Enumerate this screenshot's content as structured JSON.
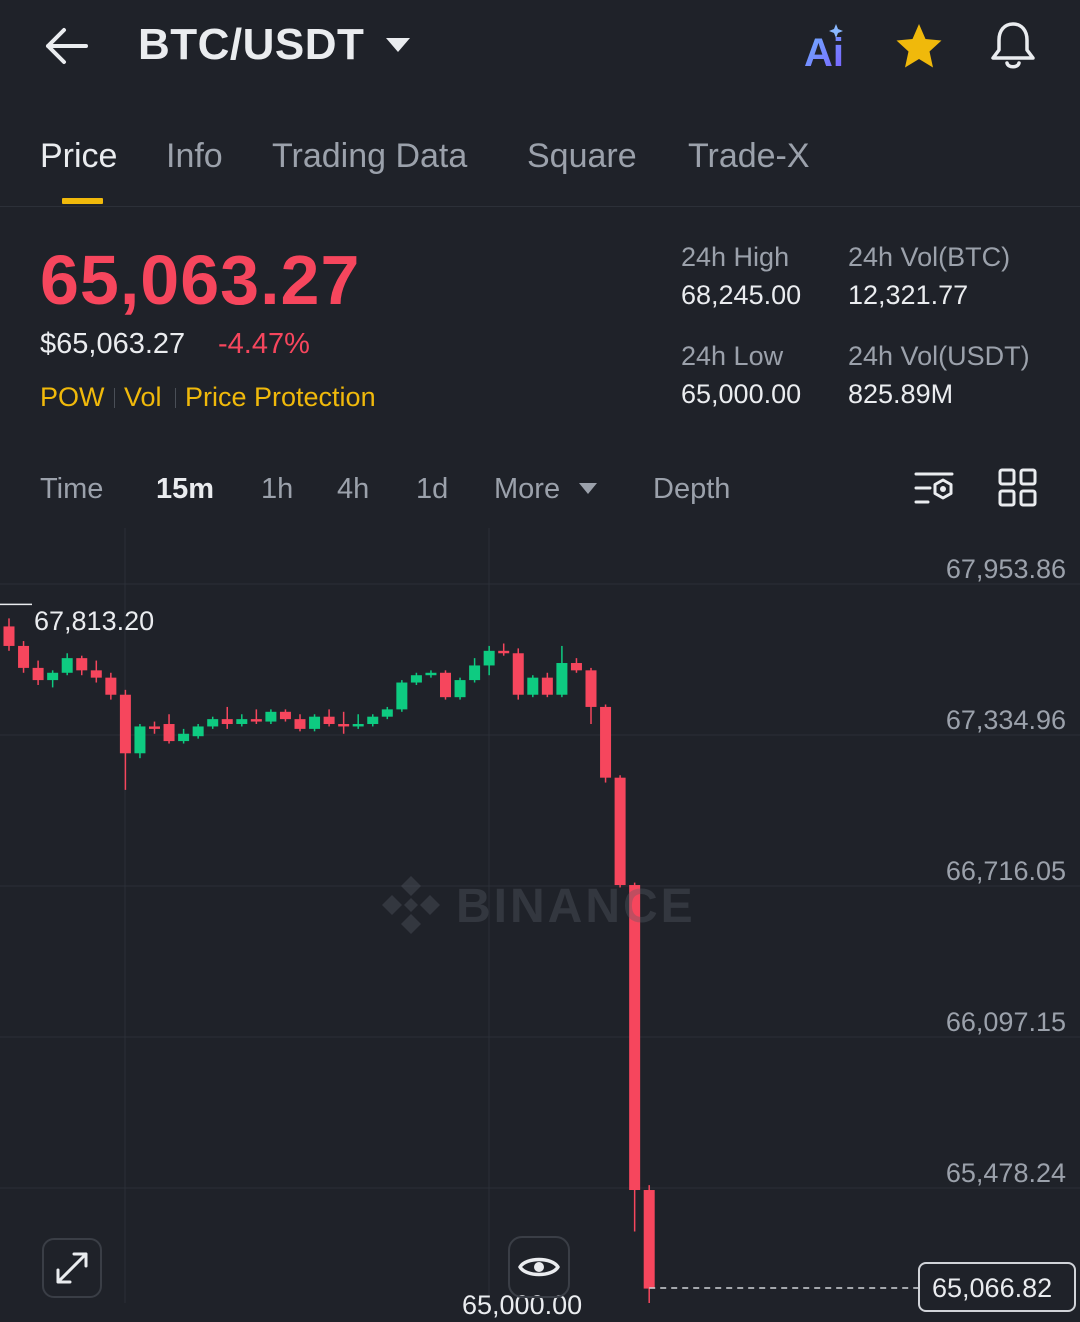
{
  "header": {
    "pair": "BTC/USDT",
    "icons": [
      "back-arrow-icon",
      "chevron-down-icon",
      "ai-icon",
      "star-icon",
      "bell-icon"
    ],
    "ai_label": "Ai"
  },
  "tabs": [
    {
      "label": "Price",
      "active": true
    },
    {
      "label": "Info",
      "active": false
    },
    {
      "label": "Trading Data",
      "active": false
    },
    {
      "label": "Square",
      "active": false
    },
    {
      "label": "Trade-X",
      "active": false
    }
  ],
  "price": {
    "last": "65,063.27",
    "usd": "$65,063.27",
    "change_pct": "-4.47%",
    "tags": [
      "POW",
      "Vol",
      "Price Protection"
    ]
  },
  "stats": {
    "high_label": "24h High",
    "high_value": "68,245.00",
    "vol_btc_label": "24h Vol(BTC)",
    "vol_btc_value": "12,321.77",
    "low_label": "24h Low",
    "low_value": "65,000.00",
    "vol_usdt_label": "24h Vol(USDT)",
    "vol_usdt_value": "825.89M"
  },
  "intervals": [
    {
      "label": "Time",
      "active": false
    },
    {
      "label": "15m",
      "active": true
    },
    {
      "label": "1h",
      "active": false
    },
    {
      "label": "4h",
      "active": false
    },
    {
      "label": "1d",
      "active": false
    },
    {
      "label": "More",
      "active": false
    },
    {
      "label": "Depth",
      "active": false
    }
  ],
  "chart_data": {
    "type": "candlestick",
    "watermark": "BINANCE",
    "y_ticks": [
      "67,953.86",
      "67,334.96",
      "66,716.05",
      "66,097.15",
      "65,478.24"
    ],
    "y_tick_values": [
      67953.86,
      67334.96,
      66716.05,
      66097.15,
      65478.24
    ],
    "high_marker": "67,813.20",
    "low_marker": "65,000.00",
    "current_price": "65,066.82",
    "colors": {
      "up": "#0ecb81",
      "down": "#f6465d",
      "background": "#1f2229",
      "grid": "#2b2f37"
    },
    "candles": [
      {
        "o": 67780,
        "h": 67813,
        "c": 67700,
        "l": 67680
      },
      {
        "o": 67700,
        "h": 67720,
        "c": 67610,
        "l": 67590
      },
      {
        "o": 67610,
        "h": 67640,
        "c": 67560,
        "l": 67540
      },
      {
        "o": 67560,
        "h": 67600,
        "c": 67590,
        "l": 67530
      },
      {
        "o": 67590,
        "h": 67670,
        "c": 67650,
        "l": 67580
      },
      {
        "o": 67650,
        "h": 67660,
        "c": 67600,
        "l": 67580
      },
      {
        "o": 67600,
        "h": 67640,
        "c": 67570,
        "l": 67550
      },
      {
        "o": 67570,
        "h": 67590,
        "c": 67500,
        "l": 67480
      },
      {
        "o": 67500,
        "h": 67520,
        "c": 67260,
        "l": 67110
      },
      {
        "o": 67260,
        "h": 67380,
        "c": 67370,
        "l": 67240
      },
      {
        "o": 67370,
        "h": 67390,
        "c": 67360,
        "l": 67340
      },
      {
        "o": 67380,
        "h": 67420,
        "c": 67310,
        "l": 67300
      },
      {
        "o": 67310,
        "h": 67360,
        "c": 67340,
        "l": 67300
      },
      {
        "o": 67330,
        "h": 67380,
        "c": 67370,
        "l": 67320
      },
      {
        "o": 67370,
        "h": 67410,
        "c": 67400,
        "l": 67360
      },
      {
        "o": 67400,
        "h": 67450,
        "c": 67380,
        "l": 67360
      },
      {
        "o": 67380,
        "h": 67420,
        "c": 67400,
        "l": 67370
      },
      {
        "o": 67400,
        "h": 67440,
        "c": 67390,
        "l": 67380
      },
      {
        "o": 67390,
        "h": 67440,
        "c": 67430,
        "l": 67380
      },
      {
        "o": 67430,
        "h": 67440,
        "c": 67400,
        "l": 67390
      },
      {
        "o": 67400,
        "h": 67420,
        "c": 67360,
        "l": 67350
      },
      {
        "o": 67360,
        "h": 67420,
        "c": 67410,
        "l": 67350
      },
      {
        "o": 67410,
        "h": 67440,
        "c": 67380,
        "l": 67370
      },
      {
        "o": 67380,
        "h": 67430,
        "c": 67370,
        "l": 67340
      },
      {
        "o": 67370,
        "h": 67420,
        "c": 67380,
        "l": 67360
      },
      {
        "o": 67380,
        "h": 67420,
        "c": 67410,
        "l": 67370
      },
      {
        "o": 67410,
        "h": 67450,
        "c": 67440,
        "l": 67400
      },
      {
        "o": 67440,
        "h": 67560,
        "c": 67550,
        "l": 67430
      },
      {
        "o": 67550,
        "h": 67590,
        "c": 67580,
        "l": 67540
      },
      {
        "o": 67580,
        "h": 67600,
        "c": 67590,
        "l": 67570
      },
      {
        "o": 67590,
        "h": 67600,
        "c": 67490,
        "l": 67480
      },
      {
        "o": 67490,
        "h": 67570,
        "c": 67560,
        "l": 67480
      },
      {
        "o": 67560,
        "h": 67650,
        "c": 67620,
        "l": 67550
      },
      {
        "o": 67620,
        "h": 67700,
        "c": 67680,
        "l": 67580
      },
      {
        "o": 67680,
        "h": 67710,
        "c": 67670,
        "l": 67660
      },
      {
        "o": 67670,
        "h": 67690,
        "c": 67500,
        "l": 67480
      },
      {
        "o": 67500,
        "h": 67580,
        "c": 67570,
        "l": 67490
      },
      {
        "o": 67570,
        "h": 67590,
        "c": 67500,
        "l": 67490
      },
      {
        "o": 67500,
        "h": 67700,
        "c": 67630,
        "l": 67490
      },
      {
        "o": 67630,
        "h": 67650,
        "c": 67600,
        "l": 67590
      },
      {
        "o": 67600,
        "h": 67610,
        "c": 67450,
        "l": 67380
      },
      {
        "o": 67450,
        "h": 67460,
        "c": 67160,
        "l": 67140
      },
      {
        "o": 67160,
        "h": 67170,
        "c": 66720,
        "l": 66710
      },
      {
        "o": 66720,
        "h": 66730,
        "c": 65470,
        "l": 65300
      },
      {
        "o": 65470,
        "h": 65490,
        "c": 65066,
        "l": 65000
      }
    ]
  }
}
